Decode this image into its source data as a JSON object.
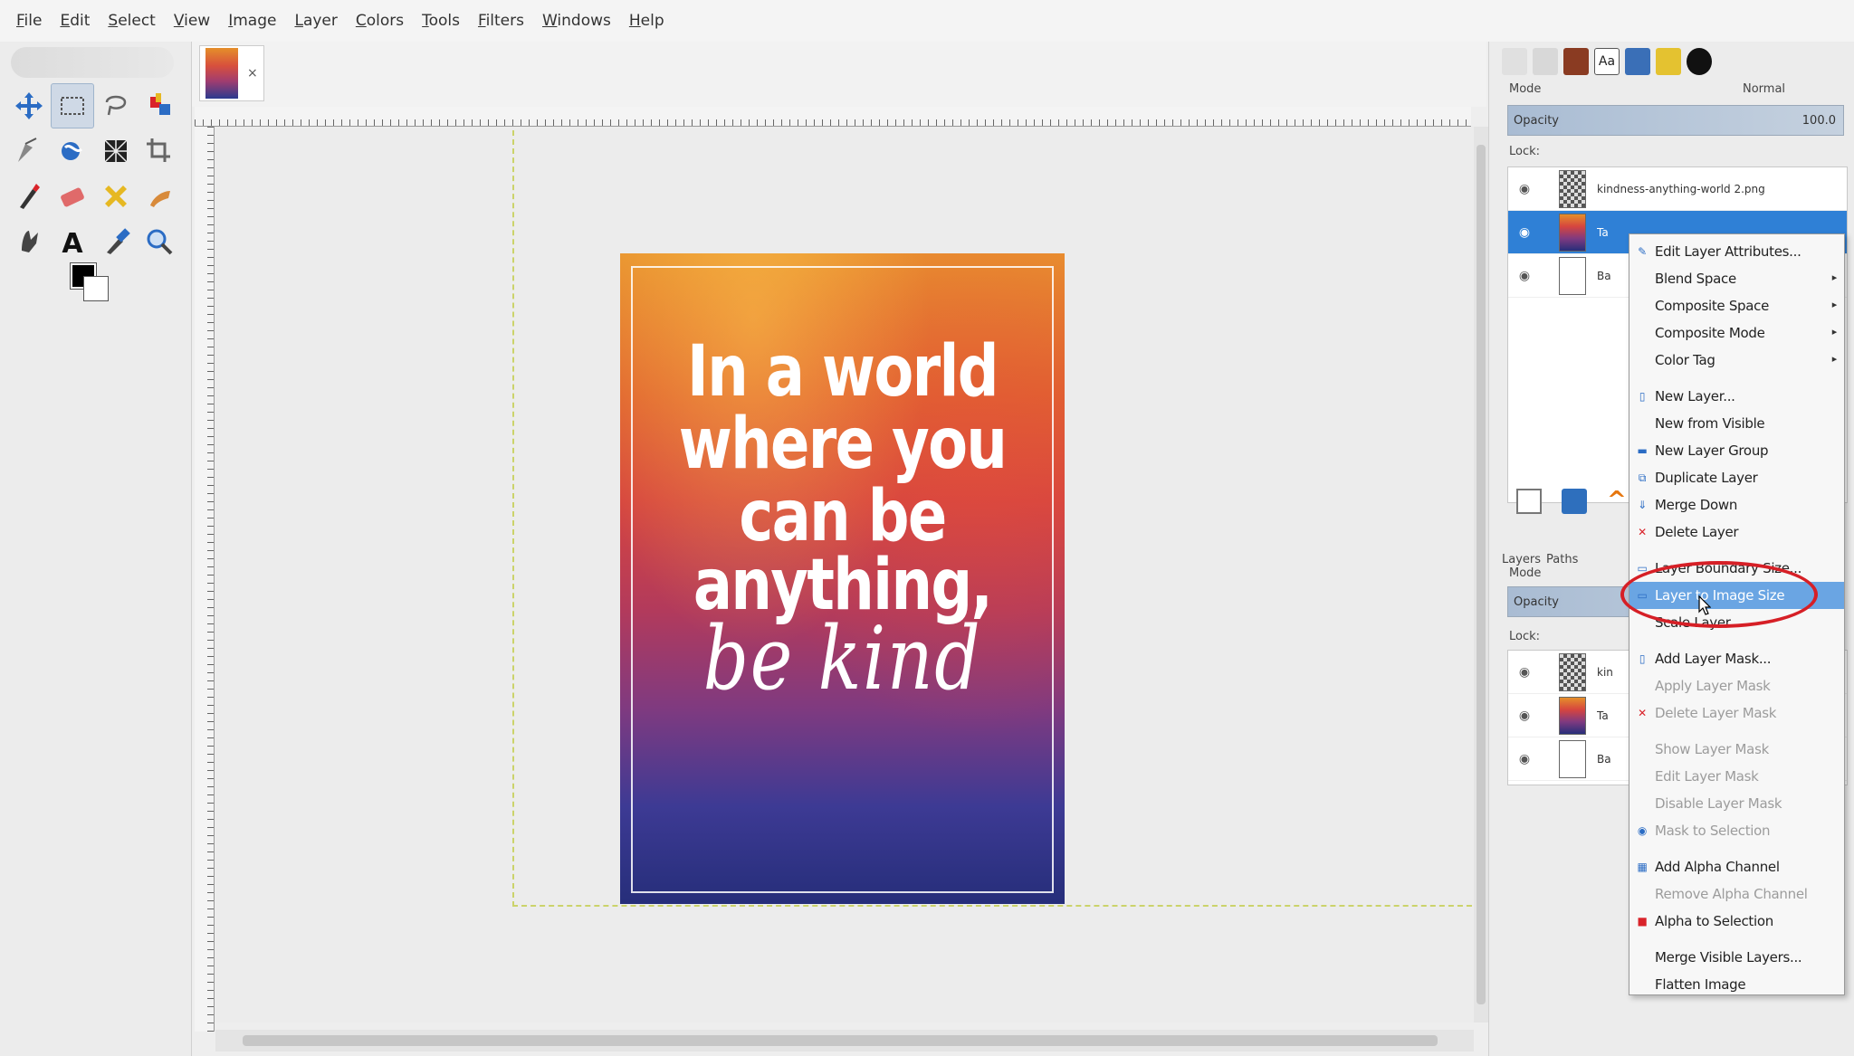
{
  "menubar": {
    "items": [
      "File",
      "Edit",
      "Select",
      "View",
      "Image",
      "Layer",
      "Colors",
      "Tools",
      "Filters",
      "Windows",
      "Help"
    ]
  },
  "toolbox": {
    "tools": [
      {
        "name": "move-tool-icon",
        "icon": "move",
        "active": false
      },
      {
        "name": "rect-select-tool-icon",
        "icon": "rect-select",
        "active": true
      },
      {
        "name": "free-select-tool-icon",
        "icon": "lasso",
        "active": false
      },
      {
        "name": "foreground-select-tool-icon",
        "icon": "fg-select",
        "active": false
      },
      {
        "name": "paths-tool-icon",
        "icon": "pen",
        "active": false
      },
      {
        "name": "warp-transform-tool-icon",
        "icon": "warp",
        "active": false
      },
      {
        "name": "texture-tool-icon",
        "icon": "texture",
        "active": false
      },
      {
        "name": "crop-tool-icon",
        "icon": "crop",
        "active": false
      },
      {
        "name": "paintbrush-tool-icon",
        "icon": "brush",
        "active": false
      },
      {
        "name": "eraser-tool-icon",
        "icon": "eraser",
        "active": false
      },
      {
        "name": "heal-tool-icon",
        "icon": "heal",
        "active": false
      },
      {
        "name": "smudge-tool-icon",
        "icon": "smudge",
        "active": false
      },
      {
        "name": "dodge-tool-icon",
        "icon": "dodge",
        "active": false
      },
      {
        "name": "text-tool-icon",
        "icon": "text",
        "active": false
      },
      {
        "name": "color-picker-tool-icon",
        "icon": "picker",
        "active": false
      },
      {
        "name": "zoom-tool-icon",
        "icon": "zoom",
        "active": false
      }
    ],
    "text_tool_glyph": "A"
  },
  "image_tab": {
    "close_glyph": "×"
  },
  "poster": {
    "lines": [
      "In a world",
      "where you",
      "can be",
      "anything,"
    ],
    "italic_line": "be kind"
  },
  "dock": {
    "mode_label": "Mode",
    "mode_value": "Normal",
    "opacity_label": "Opacity",
    "opacity_value": "100.0",
    "lock_label": "Lock:",
    "layers": [
      {
        "name": "kindness-anything-world 2.png",
        "thumb": "checker",
        "selected": false
      },
      {
        "name": "Ta",
        "thumb": "poster",
        "selected": true
      },
      {
        "name": "Ba",
        "thumb": "white",
        "selected": false
      }
    ],
    "lower_tabs": [
      "Layers",
      "Paths"
    ],
    "lower_layers": [
      {
        "name": "kin",
        "thumb": "checker"
      },
      {
        "name": "Ta",
        "thumb": "poster"
      },
      {
        "name": "Ba",
        "thumb": "white"
      }
    ]
  },
  "context_menu": {
    "groups": [
      [
        {
          "label": "Edit Layer Attributes...",
          "icon": "✎",
          "disabled": false,
          "submenu": false
        },
        {
          "label": "Blend Space",
          "icon": "",
          "disabled": false,
          "submenu": true
        },
        {
          "label": "Composite Space",
          "icon": "",
          "disabled": false,
          "submenu": true
        },
        {
          "label": "Composite Mode",
          "icon": "",
          "disabled": false,
          "submenu": true
        },
        {
          "label": "Color Tag",
          "icon": "",
          "disabled": false,
          "submenu": true
        }
      ],
      [
        {
          "label": "New Layer...",
          "icon": "▯",
          "disabled": false,
          "submenu": false
        },
        {
          "label": "New from Visible",
          "icon": "",
          "disabled": false,
          "submenu": false
        },
        {
          "label": "New Layer Group",
          "icon": "▬",
          "disabled": false,
          "submenu": false
        },
        {
          "label": "Duplicate Layer",
          "icon": "⧉",
          "disabled": false,
          "submenu": false
        },
        {
          "label": "Merge Down",
          "icon": "⇓",
          "disabled": false,
          "submenu": false
        },
        {
          "label": "Delete Layer",
          "icon": "✕",
          "disabled": false,
          "submenu": false
        }
      ],
      [
        {
          "label": "Layer Boundary Size...",
          "icon": "▭",
          "disabled": false,
          "submenu": false
        },
        {
          "label": "Layer to Image Size",
          "icon": "▭",
          "disabled": false,
          "submenu": false,
          "hover": true
        },
        {
          "label": "Scale Layer...",
          "icon": "",
          "disabled": false,
          "submenu": false
        }
      ],
      [
        {
          "label": "Add Layer Mask...",
          "icon": "▯",
          "disabled": false,
          "submenu": false
        },
        {
          "label": "Apply Layer Mask",
          "icon": "",
          "disabled": true,
          "submenu": false
        },
        {
          "label": "Delete Layer Mask",
          "icon": "✕",
          "disabled": true,
          "submenu": false
        }
      ],
      [
        {
          "label": "Show Layer Mask",
          "icon": "",
          "disabled": true,
          "submenu": false
        },
        {
          "label": "Edit Layer Mask",
          "icon": "",
          "disabled": true,
          "submenu": false
        },
        {
          "label": "Disable Layer Mask",
          "icon": "",
          "disabled": true,
          "submenu": false
        },
        {
          "label": "Mask to Selection",
          "icon": "◉",
          "disabled": true,
          "submenu": false
        }
      ],
      [
        {
          "label": "Add Alpha Channel",
          "icon": "▦",
          "disabled": false,
          "submenu": false
        },
        {
          "label": "Remove Alpha Channel",
          "icon": "",
          "disabled": true,
          "submenu": false
        },
        {
          "label": "Alpha to Selection",
          "icon": "■",
          "disabled": false,
          "submenu": false
        }
      ],
      [
        {
          "label": "Merge Visible Layers...",
          "icon": "",
          "disabled": false,
          "submenu": false
        },
        {
          "label": "Flatten Image",
          "icon": "",
          "disabled": false,
          "submenu": false
        }
      ]
    ]
  },
  "colors": {
    "selection_blue": "#2f80d6",
    "menu_hover": "#6aa5e3",
    "highlight_ring": "#d61f26",
    "delete_red": "#d9232a"
  }
}
